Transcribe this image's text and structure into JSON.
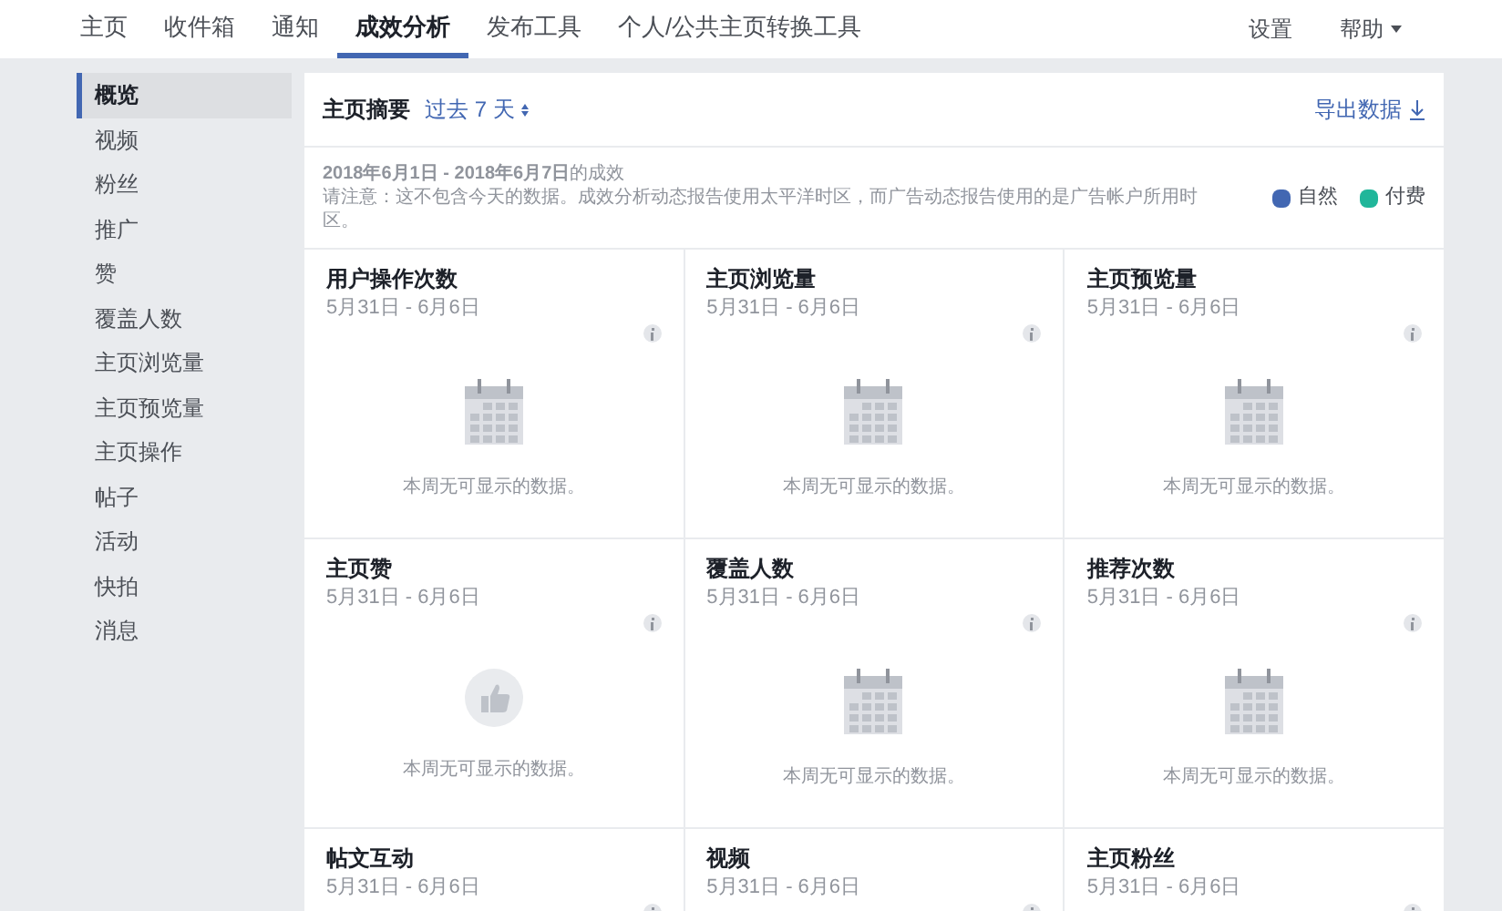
{
  "nav": {
    "tabs": [
      {
        "label": "主页",
        "selected": false
      },
      {
        "label": "收件箱",
        "selected": false
      },
      {
        "label": "通知",
        "selected": false
      },
      {
        "label": "成效分析",
        "selected": true
      },
      {
        "label": "发布工具",
        "selected": false
      },
      {
        "label": "个人/公共主页转换工具",
        "selected": false
      }
    ],
    "right": [
      {
        "label": "设置",
        "dropdown": false
      },
      {
        "label": "帮助",
        "dropdown": true
      }
    ]
  },
  "sidebar": {
    "items": [
      {
        "label": "概览",
        "selected": true
      },
      {
        "label": "视频",
        "selected": false
      },
      {
        "label": "粉丝",
        "selected": false
      },
      {
        "label": "推广",
        "selected": false
      },
      {
        "label": "赞",
        "selected": false
      },
      {
        "label": "覆盖人数",
        "selected": false
      },
      {
        "label": "主页浏览量",
        "selected": false
      },
      {
        "label": "主页预览量",
        "selected": false
      },
      {
        "label": "主页操作",
        "selected": false
      },
      {
        "label": "帖子",
        "selected": false
      },
      {
        "label": "活动",
        "selected": false
      },
      {
        "label": "快拍",
        "selected": false
      },
      {
        "label": "消息",
        "selected": false
      }
    ]
  },
  "summary": {
    "title": "主页摘要",
    "range": "过去 7 天",
    "export": "导出数据",
    "period": "**2018年6月1日 - 2018年6月7日**的成效",
    "note": "请注意：这不包含今天的数据。成效分析动态报告使用太平洋时区，而广告动态报告使用的是广告帐户所用时区。",
    "legend": [
      {
        "label": "自然",
        "color": "#4267b2"
      },
      {
        "label": "付费",
        "color": "#20b69a"
      }
    ]
  },
  "cards": [
    {
      "title": "用户操作次数",
      "dates": "5月31日 - 6月6日",
      "kind": "calendar",
      "message": "本周无可显示的数据。"
    },
    {
      "title": "主页浏览量",
      "dates": "5月31日 - 6月6日",
      "kind": "calendar",
      "message": "本周无可显示的数据。"
    },
    {
      "title": "主页预览量",
      "dates": "5月31日 - 6月6日",
      "kind": "calendar",
      "message": "本周无可显示的数据。"
    },
    {
      "title": "主页赞",
      "dates": "5月31日 - 6月6日",
      "kind": "like",
      "message": "本周无可显示的数据。"
    },
    {
      "title": "覆盖人数",
      "dates": "5月31日 - 6月6日",
      "kind": "calendar",
      "message": "本周无可显示的数据。"
    },
    {
      "title": "推荐次数",
      "dates": "5月31日 - 6月6日",
      "kind": "calendar",
      "message": "本周无可显示的数据。"
    },
    {
      "title": "帖文互动",
      "dates": "5月31日 - 6月6日"
    },
    {
      "title": "视频",
      "dates": "5月31日 - 6月6日"
    },
    {
      "title": "主页粉丝",
      "dates": "5月31日 - 6月6日"
    }
  ]
}
